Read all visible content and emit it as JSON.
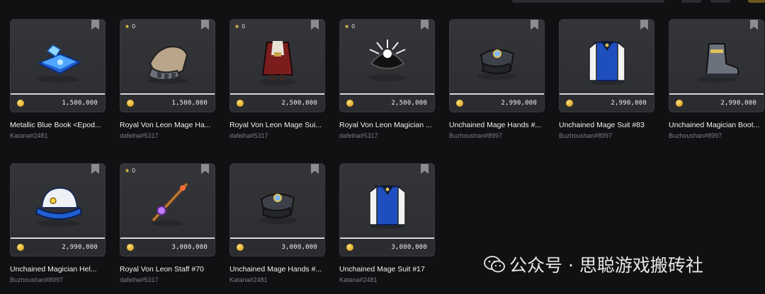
{
  "items": [
    {
      "name": "Metallic Blue Book <Epod...",
      "seller": "Katana#2481",
      "price": "1,500,000",
      "favorites": null,
      "icon": "blue-book-icon"
    },
    {
      "name": "Royal Von Leon Mage Ha...",
      "seller": "dafeiha#5317",
      "price": "1,500,000",
      "favorites": "0",
      "icon": "gauntlet-icon"
    },
    {
      "name": "Royal Von Leon Mage Sui...",
      "seller": "dafeiha#5317",
      "price": "2,500,000",
      "favorites": "0",
      "icon": "mage-suit-icon"
    },
    {
      "name": "Royal Von Leon Magician ...",
      "seller": "dafeiha#5317",
      "price": "2,500,000",
      "favorites": "0",
      "icon": "spiked-hat-icon"
    },
    {
      "name": "Unchained Mage Hands #...",
      "seller": "Buzhoushan#8997",
      "price": "2,990,000",
      "favorites": null,
      "icon": "gloves-icon"
    },
    {
      "name": "Unchained Mage Suit #83",
      "seller": "Buzhoushan#8997",
      "price": "2,990,000",
      "favorites": null,
      "icon": "robe-icon"
    },
    {
      "name": "Unchained Magician Boot...",
      "seller": "Buzhoushan#8997",
      "price": "2,990,000",
      "favorites": null,
      "icon": "boot-icon"
    },
    {
      "name": "Unchained Magician Hel...",
      "seller": "Buzhoushan#8997",
      "price": "2,990,000",
      "favorites": null,
      "icon": "helmet-icon"
    },
    {
      "name": "Royal Von Leon Staff #70",
      "seller": "dafeiha#5317",
      "price": "3,000,000",
      "favorites": "0",
      "icon": "staff-icon"
    },
    {
      "name": "Unchained Mage Hands #...",
      "seller": "Katana#2481",
      "price": "3,000,000",
      "favorites": null,
      "icon": "gloves-icon"
    },
    {
      "name": "Unchained Mage Suit #17",
      "seller": "Katana#2481",
      "price": "3,000,000",
      "favorites": null,
      "icon": "robe-icon"
    }
  ],
  "watermark": {
    "text": "公众号 · 思聪游戏搬砖社",
    "icon": "wechat-icon"
  },
  "colors": {
    "accent_gold": "#f2c94c",
    "card_bg": "#2b2c2f",
    "page_bg": "#101113"
  }
}
